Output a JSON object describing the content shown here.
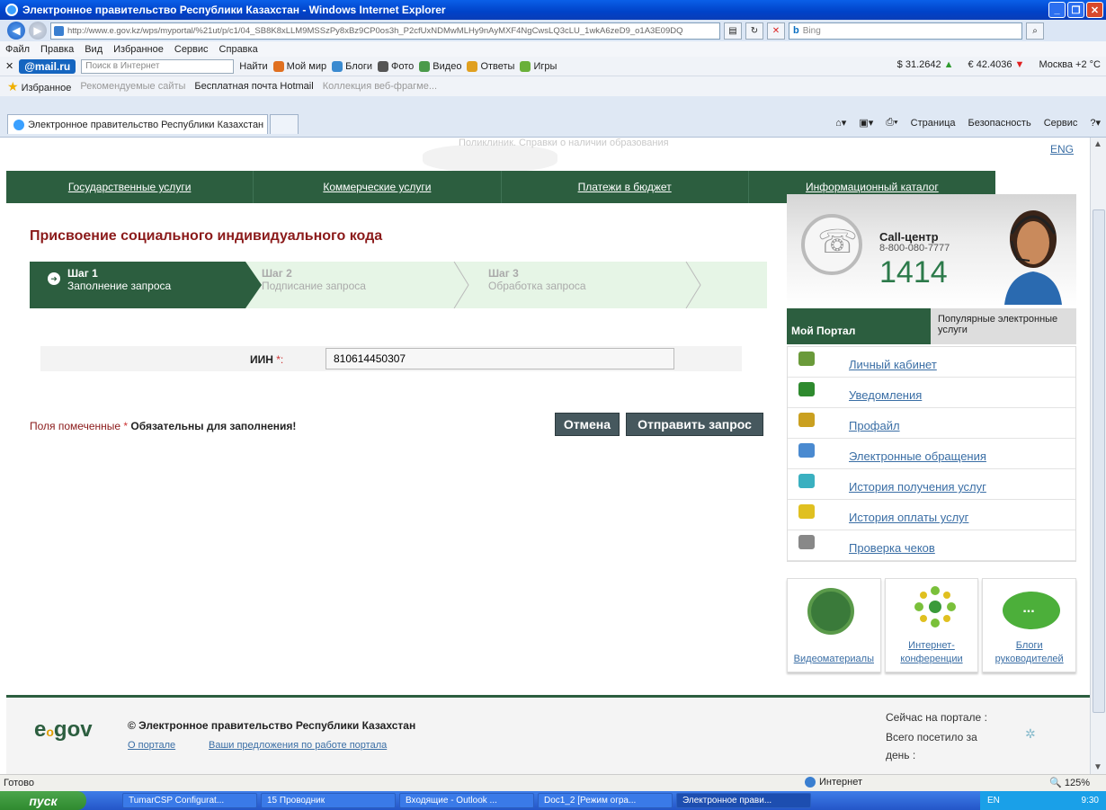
{
  "browser": {
    "window_title": "Электронное правительство Республики Казахстан - Windows Internet Explorer",
    "url": "http://www.e.gov.kz/wps/myportal/%21ut/p/c1/04_SB8K8xLLM9MSSzPy8xBz9CP0os3h_P2cfUxNDMwMLHy9nAyMXF4NgCwsLQ3cLU_1wkA6zeD9_o1A3E09DQ",
    "search_engine": "Bing",
    "menu": [
      "Файл",
      "Правка",
      "Вид",
      "Избранное",
      "Сервис",
      "Справка"
    ],
    "mail_toolbar": {
      "logo": "@mail.ru",
      "search_placeholder": "Поиск в Интернет",
      "find": "Найти",
      "links": [
        "Мой мир",
        "Блоги",
        "Фото",
        "Видео",
        "Ответы",
        "Игры"
      ],
      "usd": "$ 31.2642",
      "eur": "€ 42.4036",
      "weather": "Москва +2 °C"
    },
    "favorites": {
      "label": "Избранное",
      "items": [
        "Рекомендуемые сайты",
        "Бесплатная почта Hotmail",
        "Коллекция веб-фрагме..."
      ]
    },
    "tab_title": "Электронное правительство Республики Казахстан",
    "commands": [
      "Страница",
      "Безопасность",
      "Сервис"
    ]
  },
  "page": {
    "eng": "ENG",
    "watermark": "Поликлиник. Справки о наличии образования",
    "nav": [
      "Государственные услуги",
      "Коммерческие услуги",
      "Платежи в бюджет",
      "Информационный каталог"
    ],
    "title": "Присвоение социального индивидуального кода",
    "steps": [
      {
        "num": "Шаг 1",
        "label": "Заполнение запроса"
      },
      {
        "num": "Шаг 2",
        "label": "Подписание запроса"
      },
      {
        "num": "Шаг 3",
        "label": "Обработка запроса"
      }
    ],
    "iin_label": "ИИН",
    "iin_req": "*:",
    "iin_value": "810614450307",
    "required_note_pre": "Поля помеченные",
    "required_star": "*",
    "required_note": "Обязательны для заполнения!",
    "cancel": "Отмена",
    "submit": "Отправить запрос"
  },
  "sidebar": {
    "callcenter_title": "Call-центр",
    "callcenter_phone": "8-800-080-7777",
    "callcenter_short": "1414",
    "tab_my": "Мой Портал",
    "tab_popular": "Популярные электронные услуги",
    "menu": [
      {
        "label": "Личный кабинет",
        "icon": "house-icon",
        "color": "#6a9a3a"
      },
      {
        "label": "Уведомления",
        "icon": "notification-icon",
        "color": "#2e8a2e"
      },
      {
        "label": "Профайл",
        "icon": "profile-icon",
        "color": "#caa020"
      },
      {
        "label": "Электронные обращения",
        "icon": "document-icon",
        "color": "#4a8ad0"
      },
      {
        "label": "История получения услуг",
        "icon": "history-icon",
        "color": "#3ab0c0"
      },
      {
        "label": "История оплаты услуг",
        "icon": "payment-icon",
        "color": "#e0c020"
      },
      {
        "label": "Проверка чеков",
        "icon": "receipt-icon",
        "color": "#888888"
      }
    ],
    "media": [
      "Видеоматериалы",
      "Интернет-конференции",
      "Блоги руководителей"
    ]
  },
  "footer": {
    "logo": "egov",
    "copyright": "© Электронное правительство Республики Казахстан",
    "about": "О портале",
    "suggestions": "Ваши предложения по работе портала",
    "online": "Сейчас на портале :",
    "visited1": "Всего посетило за",
    "visited2": "день :"
  },
  "status": {
    "text": "Готово",
    "zone": "Интернет",
    "zoom": "125%"
  },
  "taskbar": {
    "start": "пуск",
    "tasks": [
      "TumarCSP Configurat...",
      "15 Проводник",
      "Входящие - Outlook ...",
      "Doc1_2 [Режим огра...",
      "Электронное прави..."
    ],
    "lang": "EN",
    "time": "9:30"
  }
}
